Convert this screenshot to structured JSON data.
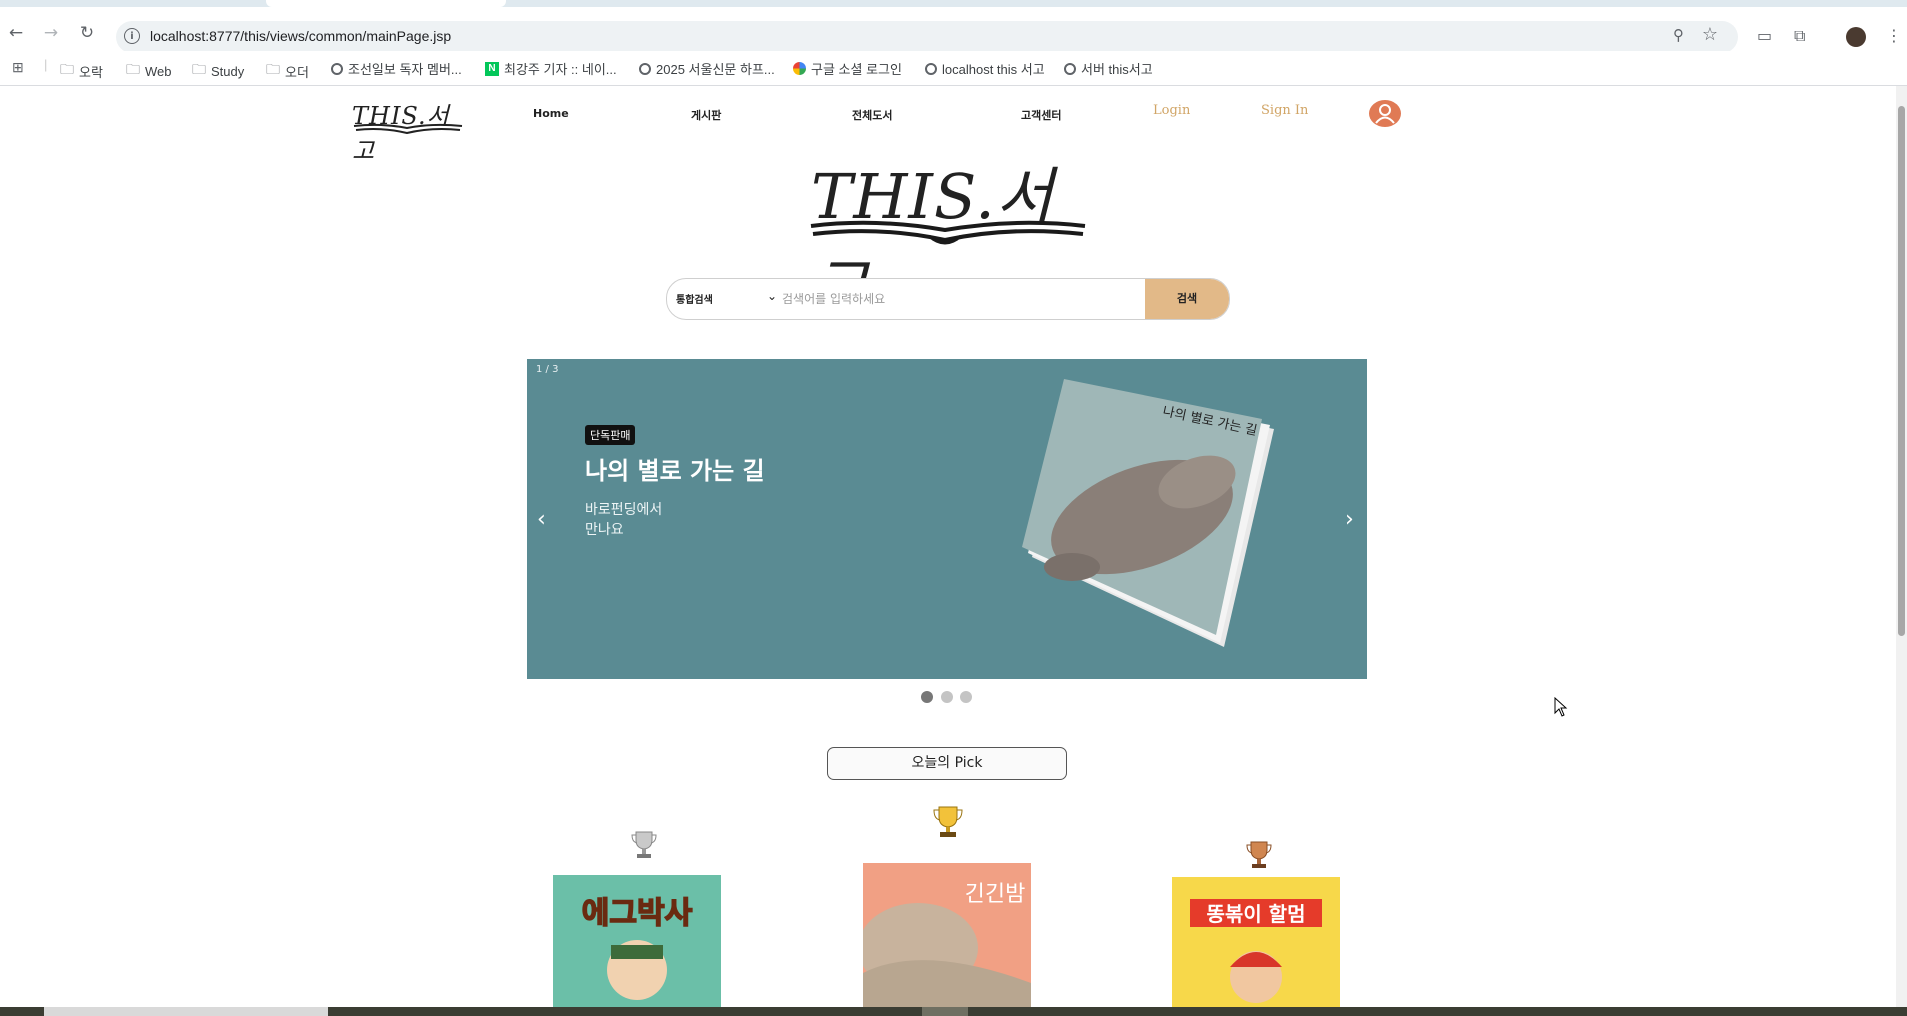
{
  "browser": {
    "url": "localhost:8777/this/views/common/mainPage.jsp",
    "bookmarks": [
      {
        "label": "오락",
        "icon": "folder-icon"
      },
      {
        "label": "Web",
        "icon": "folder-icon"
      },
      {
        "label": "Study",
        "icon": "folder-icon"
      },
      {
        "label": "오더",
        "icon": "folder-icon"
      },
      {
        "label": "조선일보 독자 멤버...",
        "icon": "globe-icon"
      },
      {
        "label": "최강주 기자 :: 네이...",
        "icon": "naver-icon"
      },
      {
        "label": "2025 서울신문 하프...",
        "icon": "globe-icon"
      },
      {
        "label": "구글 소셜 로그인",
        "icon": "google-icon"
      },
      {
        "label": "localhost this 서고",
        "icon": "globe-icon"
      },
      {
        "label": "서버 this서고",
        "icon": "globe-icon"
      }
    ]
  },
  "site": {
    "logo": "THIS.서고",
    "nav": {
      "home": "Home",
      "board": "게시판",
      "books": "전체도서",
      "support": "고객센터",
      "login": "Login",
      "signup": "Sign In"
    },
    "big_logo": "THIS.서고"
  },
  "search": {
    "category": "통합검색",
    "placeholder": "검색어를 입력하세요",
    "button": "검색"
  },
  "banner": {
    "counter": "1 / 3",
    "badge": "단독판매",
    "title": "나의 별로 가는 길",
    "subtitle_line1": "바로펀딩에서",
    "subtitle_line2": "만나요",
    "book_cover_title": "나의 별로 가는 길",
    "background_color": "#5a8b93",
    "slides_total": 3,
    "active_slide": 1
  },
  "pick": {
    "heading": "오늘의 Pick",
    "items": [
      {
        "rank": "silver",
        "cover_title": "에그박사"
      },
      {
        "rank": "gold",
        "cover_title": "긴긴밤"
      },
      {
        "rank": "bronze",
        "cover_title": "똥볶이 할멈"
      }
    ]
  },
  "colors": {
    "accent": "#e2b988",
    "nav_gold": "#d1a566",
    "avatar": "#e07a55"
  }
}
